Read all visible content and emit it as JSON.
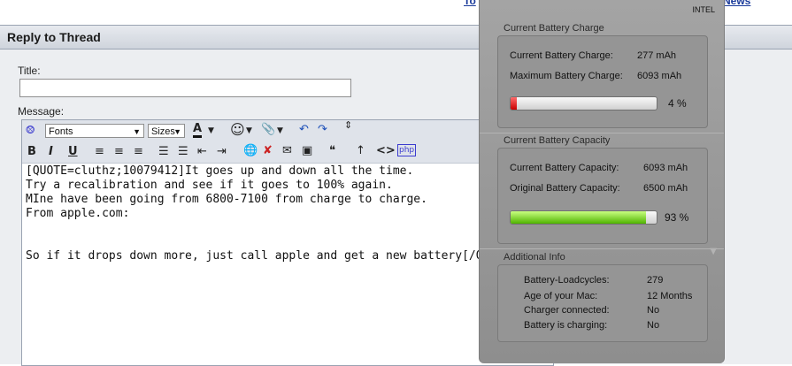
{
  "top_links": [
    "To",
    "News"
  ],
  "thread": {
    "header": "Reply to Thread",
    "title_label": "Title:",
    "title_value": "",
    "message_label": "Message:"
  },
  "toolbar": {
    "font_select": "Fonts",
    "size_select": "Sizes",
    "bold": "B",
    "italic": "I",
    "underline": "U",
    "code_icon": "<>",
    "php_icon": "php"
  },
  "editor": {
    "lines": [
      "[QUOTE=cluthz;10079412]It goes up and down all the time.",
      "Try a recalibration and see if it goes to 100% again.",
      "MIne have been going from 6800-7100 from charge to charge.",
      "From apple.com:",
      "",
      "",
      "So if it drops down more, just call apple and get a new battery[/QUOTE]"
    ]
  },
  "battery_window": {
    "badge": "INTEL",
    "charge": {
      "title": "Current Battery Charge",
      "current_label": "Current Battery Charge:",
      "current_value": "277 mAh",
      "max_label": "Maximum Battery Charge:",
      "max_value": "6093 mAh",
      "percent": 4,
      "percent_text": "4 %"
    },
    "capacity": {
      "title": "Current Battery Capacity",
      "current_label": "Current Battery Capacity:",
      "current_value": "6093 mAh",
      "original_label": "Original Battery Capacity:",
      "original_value": "6500 mAh",
      "percent": 93,
      "percent_text": "93 %"
    },
    "additional": {
      "title": "Additional Info",
      "rows": [
        {
          "label": "Battery-Loadcycles:",
          "value": "279"
        },
        {
          "label": "Age of your Mac:",
          "value": "12 Months"
        },
        {
          "label": "Charger connected:",
          "value": "No"
        },
        {
          "label": "Battery is charging:",
          "value": "No"
        }
      ]
    }
  }
}
